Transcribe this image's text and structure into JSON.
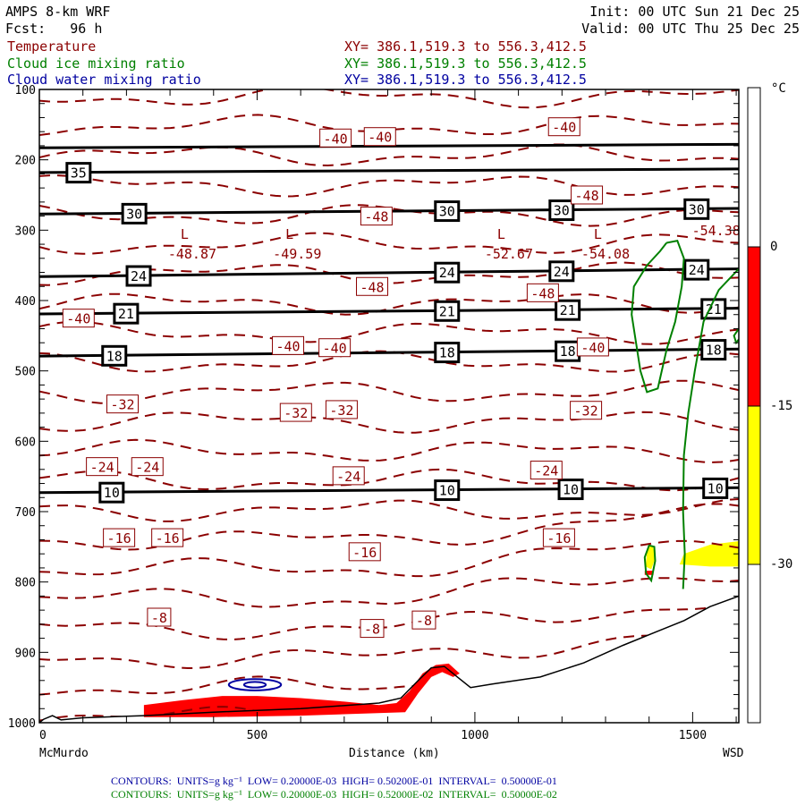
{
  "header": {
    "model": "AMPS 8-km WRF",
    "fcst": "Fcst:   96 h",
    "init": "Init: 00 UTC Sun 21 Dec 25",
    "valid": "Valid: 00 UTC Thu 25 Dec 25",
    "fields": [
      {
        "name": "Temperature",
        "xy": "XY= 386.1,519.3 to 556.3,412.5",
        "color": "#8b0000"
      },
      {
        "name": "Cloud ice mixing ratio",
        "xy": "XY= 386.1,519.3 to 556.3,412.5",
        "color": "#008000"
      },
      {
        "name": "Cloud water mixing ratio",
        "xy": "XY= 386.1,519.3 to 556.3,412.5",
        "color": "#0000a0"
      }
    ]
  },
  "footer": {
    "blue": "CONTOURS:  UNITS=g kg⁻¹  LOW= 0.20000E-03  HIGH= 0.50200E-01  INTERVAL=  0.50000E-01",
    "green": "CONTOURS:  UNITS=g kg⁻¹  LOW= 0.20000E-03  HIGH= 0.52000E-02  INTERVAL=  0.50000E-02"
  },
  "colorbar": {
    "unit": "°C",
    "ticks": [
      "0",
      "-15",
      "-30"
    ],
    "bands": [
      {
        "from": "above 0",
        "color": "#ffffff"
      },
      {
        "from": "0 to -15",
        "color": "#ff0000"
      },
      {
        "from": "-15 to -30",
        "color": "#ffff00"
      },
      {
        "from": "below -30",
        "color": "#ffffff"
      }
    ]
  },
  "chart_data": {
    "type": "cross-section",
    "xlabel": "Distance (km)",
    "x_start_label": "McMurdo",
    "x_end_label": "WSD",
    "xlim": [
      0,
      1606
    ],
    "ylim": [
      100,
      1000
    ],
    "xticks": [
      0,
      500,
      1000,
      1500
    ],
    "yticks": [
      100,
      200,
      300,
      400,
      500,
      600,
      700,
      800,
      900,
      1000
    ],
    "solid_lines": [
      {
        "label": "",
        "p_left": 183,
        "p_right": 178,
        "label_x": []
      },
      {
        "label": "35",
        "p_left": 218,
        "p_right": 213,
        "label_x": [
          90
        ]
      },
      {
        "label": "30",
        "p_left": 277,
        "p_right": 269,
        "label_x": [
          218,
          936,
          1199,
          1509
        ]
      },
      {
        "label": "24",
        "p_left": 366,
        "p_right": 355,
        "label_x": [
          228,
          936,
          1199,
          1509
        ]
      },
      {
        "label": "21",
        "p_left": 419,
        "p_right": 411,
        "label_x": [
          199,
          936,
          1213,
          1548
        ]
      },
      {
        "label": "18",
        "p_left": 479,
        "p_right": 469,
        "label_x": [
          172,
          936,
          1213,
          1548
        ]
      },
      {
        "label": "10",
        "p_left": 673,
        "p_right": 666,
        "label_x": [
          166,
          936,
          1220,
          1552
        ]
      }
    ],
    "temperature_labels": [
      {
        "t": "-40",
        "x": 680,
        "p": 169
      },
      {
        "t": "-40",
        "x": 782,
        "p": 167
      },
      {
        "t": "-40",
        "x": 1205,
        "p": 153
      },
      {
        "t": "-48",
        "x": 774,
        "p": 280
      },
      {
        "t": "-48",
        "x": 1257,
        "p": 250
      },
      {
        "t": "-48",
        "x": 764,
        "p": 380
      },
      {
        "t": "-48",
        "x": 1156,
        "p": 389
      },
      {
        "t": "-40",
        "x": 90,
        "p": 425
      },
      {
        "t": "-40",
        "x": 571,
        "p": 464
      },
      {
        "t": "-40",
        "x": 678,
        "p": 467
      },
      {
        "t": "-40",
        "x": 1271,
        "p": 466
      },
      {
        "t": "-32",
        "x": 191,
        "p": 547
      },
      {
        "t": "-32",
        "x": 589,
        "p": 559
      },
      {
        "t": "-32",
        "x": 694,
        "p": 555
      },
      {
        "t": "-32",
        "x": 1255,
        "p": 556
      },
      {
        "t": "-24",
        "x": 144,
        "p": 636
      },
      {
        "t": "-24",
        "x": 248,
        "p": 636
      },
      {
        "t": "-24",
        "x": 710,
        "p": 649
      },
      {
        "t": "-24",
        "x": 1164,
        "p": 641
      },
      {
        "t": "-16",
        "x": 183,
        "p": 737
      },
      {
        "t": "-16",
        "x": 294,
        "p": 737
      },
      {
        "t": "-16",
        "x": 747,
        "p": 757
      },
      {
        "t": "-16",
        "x": 1193,
        "p": 737
      },
      {
        "t": "-8",
        "x": 275,
        "p": 850
      },
      {
        "t": "-8",
        "x": 764,
        "p": 866
      },
      {
        "t": "-8",
        "x": 883,
        "p": 854
      }
    ],
    "lows": [
      {
        "mark": "L",
        "value": "-48.87",
        "x": 357,
        "p": 335
      },
      {
        "mark": "L",
        "value": "-49.59",
        "x": 598,
        "p": 335
      },
      {
        "mark": "L",
        "value": "-52.67",
        "x": 1084,
        "p": 335
      },
      {
        "mark": "L",
        "value": "-54.08",
        "x": 1306,
        "p": 335
      },
      {
        "mark": "",
        "value": "-54.38",
        "x": 1560,
        "p": 302
      }
    ],
    "terrain": [
      [
        0,
        1000
      ],
      [
        10,
        995
      ],
      [
        30,
        990
      ],
      [
        50,
        996
      ],
      [
        100,
        993
      ],
      [
        240,
        990
      ],
      [
        400,
        985
      ],
      [
        600,
        980
      ],
      [
        780,
        972
      ],
      [
        830,
        965
      ],
      [
        870,
        940
      ],
      [
        900,
        922
      ],
      [
        930,
        920
      ],
      [
        960,
        935
      ],
      [
        990,
        950
      ],
      [
        1040,
        945
      ],
      [
        1150,
        935
      ],
      [
        1250,
        915
      ],
      [
        1340,
        890
      ],
      [
        1420,
        870
      ],
      [
        1480,
        855
      ],
      [
        1540,
        835
      ],
      [
        1606,
        820
      ]
    ],
    "shading": [
      {
        "band": "0 to -15",
        "points": [
          [
            240,
            992
          ],
          [
            240,
            975
          ],
          [
            330,
            968
          ],
          [
            420,
            962
          ],
          [
            500,
            962
          ],
          [
            600,
            965
          ],
          [
            700,
            970
          ],
          [
            780,
            975
          ],
          [
            820,
            972
          ],
          [
            850,
            955
          ],
          [
            880,
            930
          ],
          [
            910,
            918
          ],
          [
            940,
            916
          ],
          [
            965,
            930
          ],
          [
            950,
            935
          ],
          [
            925,
            928
          ],
          [
            900,
            935
          ],
          [
            870,
            958
          ],
          [
            840,
            985
          ],
          [
            600,
            990
          ],
          [
            400,
            992
          ]
        ]
      },
      {
        "band": "-15 to -30",
        "points": [
          [
            1470,
            775
          ],
          [
            1480,
            760
          ],
          [
            1540,
            747
          ],
          [
            1606,
            742
          ],
          [
            1606,
            778
          ],
          [
            1540,
            778
          ]
        ]
      },
      {
        "band": "-15 to -30",
        "points": [
          [
            1392,
            778
          ],
          [
            1396,
            752
          ],
          [
            1408,
            748
          ],
          [
            1415,
            765
          ],
          [
            1405,
            782
          ]
        ]
      },
      {
        "band": "0 to -15",
        "points": [
          [
            1390,
            784
          ],
          [
            1410,
            784
          ],
          [
            1410,
            790
          ],
          [
            1390,
            790
          ]
        ]
      }
    ],
    "cloud_ice_contours": [
      [
        [
          1440,
          318
        ],
        [
          1465,
          315
        ],
        [
          1480,
          340
        ],
        [
          1475,
          380
        ],
        [
          1460,
          430
        ],
        [
          1440,
          470
        ],
        [
          1420,
          525
        ],
        [
          1395,
          530
        ],
        [
          1380,
          500
        ],
        [
          1370,
          460
        ],
        [
          1360,
          420
        ],
        [
          1365,
          380
        ],
        [
          1395,
          350
        ],
        [
          1425,
          330
        ],
        [
          1440,
          318
        ]
      ],
      [
        [
          1606,
          355
        ],
        [
          1560,
          385
        ],
        [
          1525,
          430
        ],
        [
          1505,
          500
        ],
        [
          1490,
          560
        ],
        [
          1480,
          620
        ],
        [
          1478,
          700
        ],
        [
          1482,
          760
        ],
        [
          1478,
          810
        ]
      ],
      [
        [
          1393,
          788
        ],
        [
          1390,
          765
        ],
        [
          1400,
          748
        ],
        [
          1412,
          750
        ],
        [
          1414,
          770
        ],
        [
          1405,
          798
        ],
        [
          1393,
          788
        ]
      ],
      [
        [
          1606,
          440
        ],
        [
          1595,
          450
        ],
        [
          1600,
          460
        ],
        [
          1606,
          455
        ]
      ]
    ],
    "cloud_water_contours": [
      {
        "x": 495,
        "p": 946,
        "rx_km": 60,
        "rp_hpa": 8
      },
      {
        "x": 495,
        "p": 946,
        "rx_km": 25,
        "rp_hpa": 4
      }
    ]
  }
}
